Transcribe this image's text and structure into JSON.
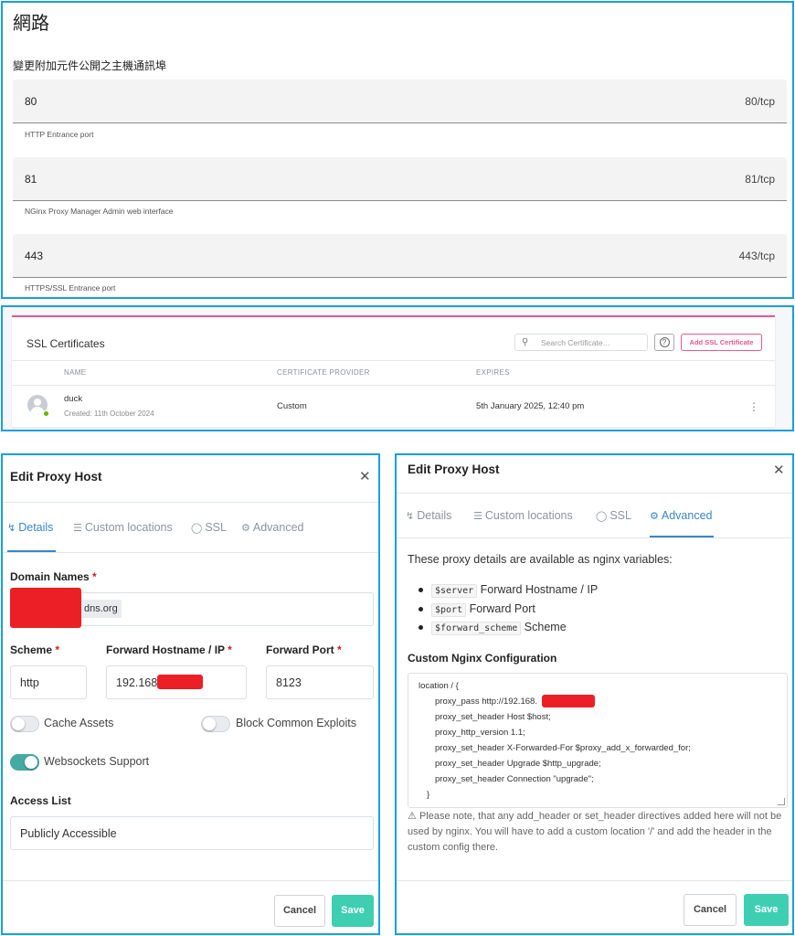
{
  "network": {
    "title": "網路",
    "subtitle": "變更附加元件公開之主機通訊埠",
    "ports": [
      {
        "value": "80",
        "unit": "80/tcp",
        "description": "HTTP Entrance port"
      },
      {
        "value": "81",
        "unit": "81/tcp",
        "description": "NGinx Proxy Manager Admin web interface"
      },
      {
        "value": "443",
        "unit": "443/tcp",
        "description": "HTTPS/SSL Entrance port"
      }
    ]
  },
  "ssl": {
    "title": "SSL Certificates",
    "search_placeholder": "Search Certificate…",
    "help_label": "?",
    "add_button": "Add SSL Certificate",
    "columns": [
      "NAME",
      "CERTIFICATE PROVIDER",
      "EXPIRES"
    ],
    "rows": [
      {
        "name": "duck",
        "created": "Created: 11th October 2024",
        "provider": "Custom",
        "expires": "5th January 2025, 12:40 pm"
      }
    ]
  },
  "edit_left": {
    "title": "Edit Proxy Host",
    "tabs": [
      "Details",
      "Custom locations",
      "SSL",
      "Advanced"
    ],
    "domain_label": "Domain Names",
    "domain_value_suffix": "dns.org",
    "scheme_label": "Scheme",
    "scheme_value": "http",
    "host_label": "Forward Hostname / IP",
    "host_value": "192.168.",
    "port_label": "Forward Port",
    "port_value": "8123",
    "required_mark": "*",
    "toggles": [
      {
        "label": "Cache Assets",
        "on": false
      },
      {
        "label": "Block Common Exploits",
        "on": false
      },
      {
        "label": "Websockets Support",
        "on": true
      }
    ],
    "access_label": "Access List",
    "access_value": "Publicly Accessible",
    "cancel": "Cancel",
    "save": "Save"
  },
  "edit_right": {
    "title": "Edit Proxy Host",
    "tabs": [
      "Details",
      "Custom locations",
      "SSL",
      "Advanced"
    ],
    "intro": "These proxy details are available as nginx variables:",
    "variables": [
      {
        "code": "$server",
        "desc": "Forward Hostname / IP"
      },
      {
        "code": "$port",
        "desc": "Forward Port"
      },
      {
        "code": "$forward_scheme",
        "desc": "Scheme"
      }
    ],
    "config_label": "Custom Nginx Configuration",
    "config_lines": [
      "location / {",
      "proxy_pass http://192.168.",
      "proxy_set_header Host $host;",
      "proxy_http_version 1.1;",
      "proxy_set_header X-Forwarded-For $proxy_add_x_forwarded_for;",
      "proxy_set_header Upgrade $http_upgrade;",
      "proxy_set_header Connection \"upgrade\";",
      "}"
    ],
    "note": "Please note, that any add_header or set_header directives added here will not be used by nginx. You will have to add a custom location '/' and add the header in the custom config there.",
    "cancel": "Cancel",
    "save": "Save"
  },
  "colors": {
    "panel_border": "#1a9ee0",
    "accent_pink": "#e8578a",
    "tab_active": "#3a86c8",
    "save_green": "#3ecfb2",
    "toggle_on": "#45aaa2",
    "redaction": "#ec1f26"
  }
}
